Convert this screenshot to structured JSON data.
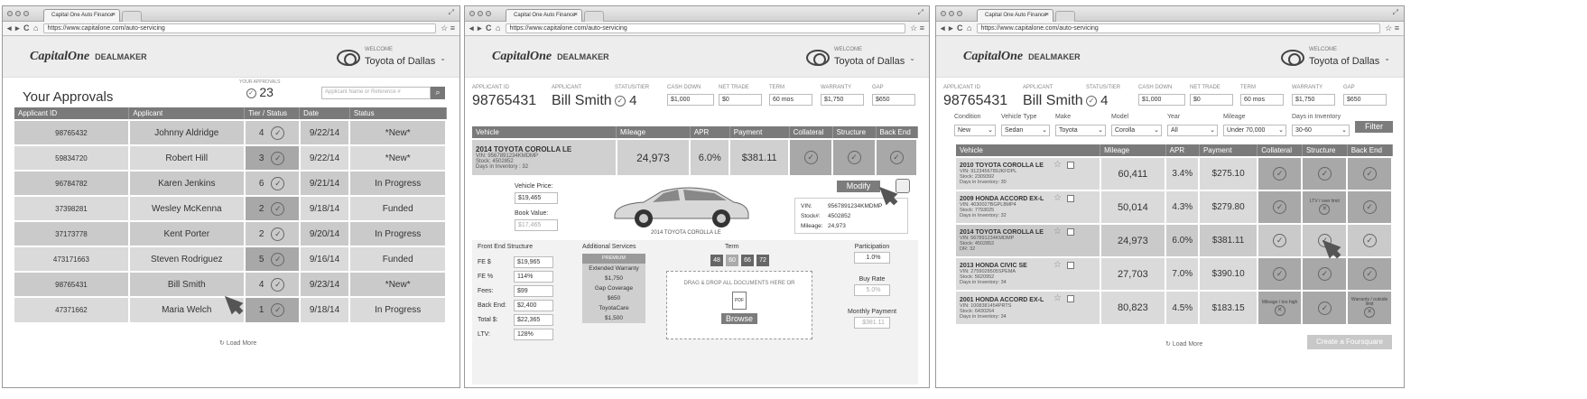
{
  "browser": {
    "tab_title": "Capital One Auto Finance",
    "tab_close": "×",
    "url": "https://www.capitalone.com/auto-servicing",
    "nav_glyphs": "◂ ▸ C ⌂",
    "lock_glyph": "🔒",
    "right_glyphs": "☆ ≡",
    "expand_glyph": "⤢"
  },
  "brand": {
    "logo": "CapitalOne",
    "product": "DEALMAKER"
  },
  "dealer": {
    "welcome": "WELCOME",
    "name": "Toyota of Dallas",
    "chevron": "⌄"
  },
  "check_glyph": "✓",
  "cross_glyph": "✕",
  "star_glyph": "☆",
  "screen1": {
    "title": "Your Approvals",
    "approvals_label": "YOUR APPROVALS",
    "approvals_count": "23",
    "search_placeholder": "Applicant Name or Reference #",
    "search_icon": "search-icon",
    "columns": [
      "Applicant ID",
      "Applicant",
      "Tier / Status",
      "Date",
      "Status"
    ],
    "rows": [
      {
        "id": "98765432",
        "name": "Johnny Aldridge",
        "tier": "4",
        "date": "9/22/14",
        "status": "*New*"
      },
      {
        "id": "59834720",
        "name": "Robert Hill",
        "tier": "3",
        "date": "9/22/14",
        "status": "*New*"
      },
      {
        "id": "96784782",
        "name": "Karen Jenkins",
        "tier": "6",
        "date": "9/21/14",
        "status": "In Progress"
      },
      {
        "id": "37398281",
        "name": "Wesley McKenna",
        "tier": "2",
        "date": "9/18/14",
        "status": "Funded"
      },
      {
        "id": "37173778",
        "name": "Kent Porter",
        "tier": "2",
        "date": "9/20/14",
        "status": "In Progress"
      },
      {
        "id": "473171663",
        "name": "Steven Rodriguez",
        "tier": "5",
        "date": "9/16/14",
        "status": "Funded"
      },
      {
        "id": "98765431",
        "name": "Bill Smith",
        "tier": "4",
        "date": "9/23/14",
        "status": "*New*"
      },
      {
        "id": "47371662",
        "name": "Maria Welch",
        "tier": "1",
        "date": "9/18/14",
        "status": "In Progress"
      }
    ],
    "load_more": "Load More"
  },
  "summary": {
    "applicant_id_label": "APPLICANT ID",
    "applicant_id": "98765431",
    "applicant_label": "APPLICANT",
    "applicant": "Bill Smith",
    "status_label": "STATUS/TIER",
    "tier": "4",
    "cash_down_label": "CASH DOWN",
    "cash_down": "$1,000",
    "net_trade_label": "NET TRADE",
    "net_trade": "$0",
    "term_label": "TERM",
    "term": "60 mos",
    "warranty_label": "WARRANTY",
    "warranty": "$1,750",
    "gap_label": "GAP",
    "gap": "$650"
  },
  "screen2": {
    "columns": [
      "Vehicle",
      "Mileage",
      "APR",
      "Payment",
      "Collateral",
      "Structure",
      "Back End"
    ],
    "vehicle": {
      "name": "2014 TOYOTA COROLLA LE",
      "vin_label": "VIN:",
      "vin": "9567891234KMDMP",
      "stock_label": "Stock:",
      "stock": "4502852",
      "days_label": "Days in Inventory :",
      "days": "32",
      "mileage": "24,973",
      "apr": "6.0%",
      "payment": "$381.11"
    },
    "vehicle_price_label": "Vehicle Price:",
    "vehicle_price": "$19,465",
    "book_value_label": "Book Value:",
    "book_value": "$17,465",
    "car_caption": "2014 TOYOTA COROLLA LE",
    "modify": "Modify",
    "detail": {
      "vin_label": "VIN:",
      "vin": "9567891234KMDMP",
      "stock_label": "Stock#:",
      "stock": "4502852",
      "mileage_label": "Mileage:",
      "mileage": "24,973"
    },
    "front_end_title": "Front End Structure",
    "front_end": [
      {
        "label": "FE $",
        "value": "$19,965"
      },
      {
        "label": "FE %",
        "value": "114%"
      },
      {
        "label": "Fees:",
        "value": "$99"
      },
      {
        "label": "Back End:",
        "value": "$2,400"
      },
      {
        "label": "Total $:",
        "value": "$22,365"
      },
      {
        "label": "LTV:",
        "value": "128%"
      }
    ],
    "services_title": "Additional Services",
    "services": [
      "PREMIUM",
      "Extended Warranty",
      "$1,750",
      "Gap Coverage",
      "$650",
      "ToyotaCare",
      "$1,500"
    ],
    "term_title": "Term",
    "term_options": [
      "48",
      "60",
      "66",
      "72"
    ],
    "drop_text": "DRAG & DROP ALL DOCUMENTS HERE OR",
    "browse": "Browse",
    "participation_label": "Participation",
    "participation": "1.0%",
    "buy_rate_label": "Buy Rate",
    "buy_rate": "5.0%",
    "monthly_label": "Monthly Payment",
    "monthly": "$381.11"
  },
  "screen3": {
    "filters": [
      {
        "label": "Condition",
        "value": "New"
      },
      {
        "label": "Vehicle Type",
        "value": "Sedan"
      },
      {
        "label": "Make",
        "value": "Toyota"
      },
      {
        "label": "Model",
        "value": "Corolla"
      },
      {
        "label": "Year",
        "value": "All"
      },
      {
        "label": "Mileage",
        "value": "Under 70,000"
      },
      {
        "label": "Days in Inventory",
        "value": "30-60"
      }
    ],
    "filter_button": "Filter",
    "columns": [
      "Vehicle",
      "Mileage",
      "APR",
      "Payment",
      "Collateral",
      "Structure",
      "Back End"
    ],
    "rows": [
      {
        "name": "2010 TOYOTA COROLLA LE",
        "vin": "9123456789JKFDPL",
        "stock": "2309392",
        "days_label": "Days in Inventory:",
        "days": "30",
        "mileage": "60,411",
        "apr": "3.4%",
        "payment": "$275.10",
        "collateral": "",
        "structure": "",
        "backend": ""
      },
      {
        "name": "2009 HONDA ACCORD EX-L",
        "vin": "4030027BGPL8MP4",
        "stock": "7793025",
        "days_label": "Days in Inventory:",
        "days": "32",
        "mileage": "50,014",
        "apr": "4.3%",
        "payment": "$279.80",
        "collateral": "",
        "structure": "LTV / over limit",
        "backend": ""
      },
      {
        "name": "2014 TOYOTA COROLLA LE",
        "vin": "567891234KMDMP",
        "stock": "4502852",
        "days_label": "DR:",
        "days": "32",
        "mileage": "24,973",
        "apr": "6.0%",
        "payment": "$381.11",
        "collateral": "",
        "structure": "",
        "backend": ""
      },
      {
        "name": "2013 HONDA CIVIC SE",
        "vin": "2759028505SPEMA",
        "stock": "5620952",
        "days_label": "Days in Inventory:",
        "days": "34",
        "mileage": "27,703",
        "apr": "7.0%",
        "payment": "$390.10",
        "collateral": "",
        "structure": "",
        "backend": ""
      },
      {
        "name": "2001 HONDA ACCORD EX-L",
        "vin": "1008381454PRTS",
        "stock": "6430264",
        "days_label": "Days in Inventory:",
        "days": "34",
        "mileage": "80,823",
        "apr": "4.5%",
        "payment": "$183.15",
        "collateral": "Mileage / too high",
        "structure": "",
        "backend": "Warranty / outside limit"
      }
    ],
    "load_more": "Load More",
    "foursquare": "Create a Foursquare"
  }
}
